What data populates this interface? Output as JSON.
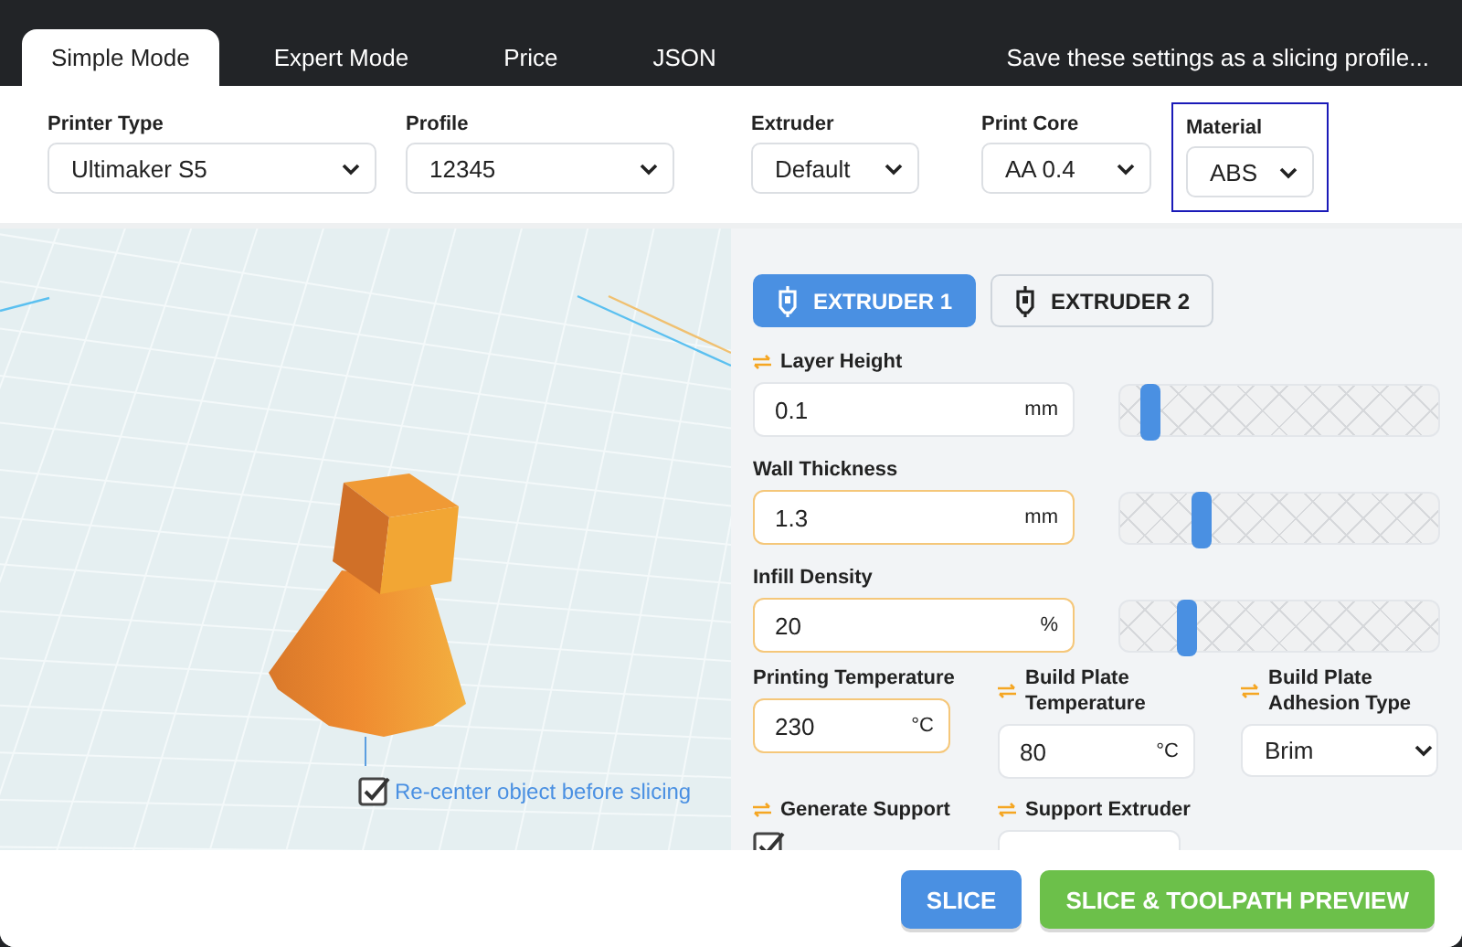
{
  "header": {
    "tabs": [
      {
        "label": "Simple Mode",
        "selected": true
      },
      {
        "label": "Expert Mode",
        "selected": false
      },
      {
        "label": "Price",
        "selected": false
      },
      {
        "label": "JSON",
        "selected": false
      }
    ],
    "save_link": "Save these settings as a slicing profile..."
  },
  "printer_options": [
    {
      "label": "Printer Type",
      "value": "Ultimaker S5",
      "focused": false
    },
    {
      "label": "Profile",
      "value": "12345",
      "focused": false
    },
    {
      "label": "Extruder",
      "value": "Default",
      "focused": false
    },
    {
      "label": "Print Core",
      "value": "AA 0.4",
      "focused": false
    },
    {
      "label": "Material",
      "value": "ABS",
      "focused": true
    }
  ],
  "viewport": {
    "recenter": {
      "label": "Re-center object before slicing",
      "checked": true
    }
  },
  "extruders": [
    {
      "label": "EXTRUDER 1",
      "selected": true
    },
    {
      "label": "EXTRUDER 2",
      "selected": false
    }
  ],
  "sliders": [
    {
      "label": "Layer Height",
      "linked": true,
      "value": "0.1",
      "unit": "mm",
      "edited": false,
      "level": 0.1
    },
    {
      "label": "Wall Thickness",
      "linked": false,
      "value": "1.3",
      "unit": "mm",
      "edited": true,
      "level": 0.26
    },
    {
      "label": "Infill Density",
      "linked": false,
      "value": "20",
      "unit": "%",
      "edited": true,
      "level": 0.21
    }
  ],
  "settings": [
    {
      "kind": "input",
      "label": "Printing Temperature",
      "linked": false,
      "value": "230",
      "unit": "°C",
      "edited": true
    },
    {
      "kind": "input",
      "label": "Build Plate Temperature",
      "linked": true,
      "value": "80",
      "unit": "°C",
      "edited": false
    },
    {
      "kind": "select",
      "label": "Build Plate Adhesion Type",
      "linked": true,
      "value": "Brim"
    },
    {
      "kind": "checkbox",
      "label": "Generate Support",
      "linked": true,
      "checked": true
    },
    {
      "kind": "input",
      "label": "Support Extruder",
      "linked": true
    }
  ],
  "footer": {
    "buttons": [
      {
        "label": "SLICE",
        "kind": "primary"
      },
      {
        "label": "SLICE & TOOLPATH PREVIEW",
        "kind": "preview"
      }
    ]
  }
}
